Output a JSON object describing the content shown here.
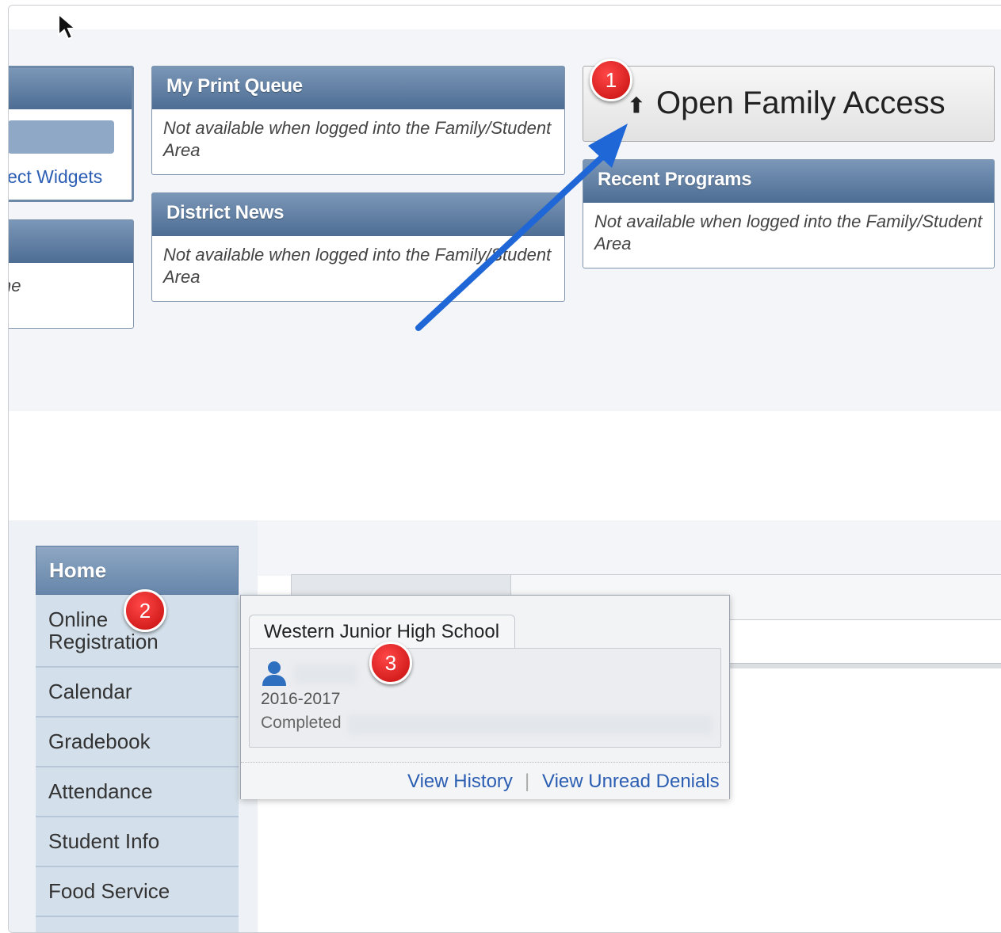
{
  "widgets_left_cutoff": {
    "select_widgets_link": "lect Widgets",
    "truncated_text": "ne"
  },
  "print_queue": {
    "title": "My Print Queue",
    "body": "Not available when logged into the Family/Student Area"
  },
  "district_news": {
    "title": "District News",
    "body": "Not available when logged into the Family/Student Area"
  },
  "family_access": {
    "label": "Open Family Access",
    "icon": "family-icon"
  },
  "recent_programs": {
    "title": "Recent Programs",
    "body": "Not available when logged into the Family/Student Area"
  },
  "menu": {
    "items": [
      "Home",
      "Online Registration",
      "Calendar",
      "Gradebook",
      "Attendance",
      "Student Info",
      "Food Service"
    ]
  },
  "popup": {
    "school_tab": "Western Junior High School",
    "year": "2016-2017",
    "status": "Completed",
    "links": {
      "history": "View History",
      "separator": "|",
      "unread": "View Unread Denials"
    }
  },
  "badges": [
    "1",
    "2",
    "3"
  ],
  "colors": {
    "widget_header": "#5f7fa4",
    "menu_item": "#d3dfea",
    "link": "#2b5eb3",
    "badge": "#d51a1a",
    "arrow": "#1f66d6"
  }
}
